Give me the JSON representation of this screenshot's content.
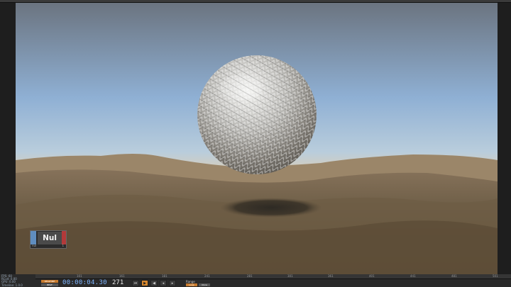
{
  "node": {
    "label": "Nul",
    "sublabel_left": "nul",
    "sublabel_right": "1"
  },
  "stats": [
    "FPS: 60",
    "RCvd: 0.00",
    "GPU: 0.00",
    "Timeline: 1.0.0"
  ],
  "ruler_ticks": [
    "101",
    "161",
    "181",
    "241",
    "281",
    "301",
    "361",
    "401",
    "441",
    "481",
    "501"
  ],
  "timeline": {
    "realtime_label": "REALTIME",
    "realtime_sub": "BEAT",
    "timecode": "00:00:04.30",
    "frame": "271",
    "range_label": "Range Limit",
    "range_loop": "Loop",
    "range_once": "Once"
  },
  "buttons": {
    "rewind": "⏮",
    "play": "▶",
    "back": "◀",
    "step_back": "◂",
    "step_fwd": "▸"
  },
  "colors": {
    "sky_top": "#6b7580",
    "sky_mid": "#a6c2dc",
    "horizon": "#f0c89a",
    "sand": "#8a7251",
    "node_input": "#5f8dbf",
    "node_output": "#b33939",
    "accent": "#d9892f"
  }
}
